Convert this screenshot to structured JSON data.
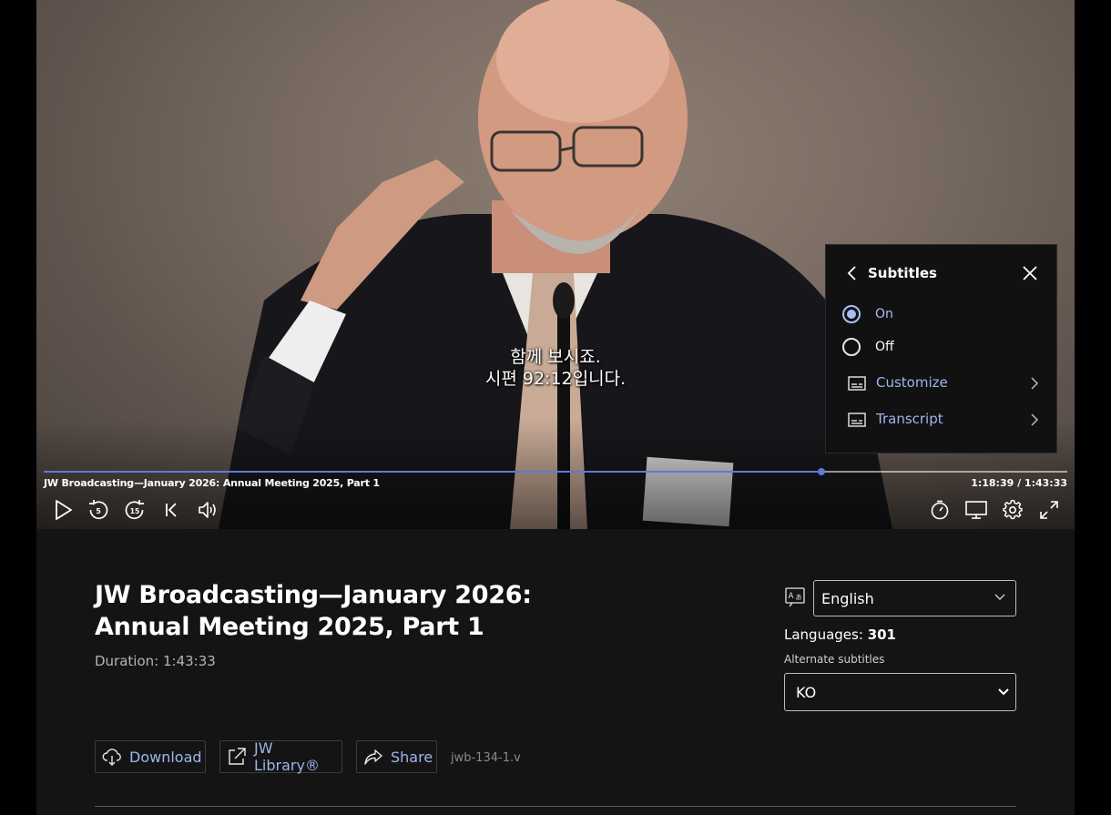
{
  "video": {
    "caption_lines": [
      "함께 보시죠.",
      "시편 92:12입니다."
    ],
    "title": "JW Broadcasting—January 2026: Annual Meeting 2025, Part 1",
    "time": "1:18:39 / 1:43:33",
    "progress": 0.76,
    "controls": [
      "play-icon",
      "rewind-5-icon",
      "forward-15-icon",
      "previous-icon",
      "volume-icon",
      "sleep-timer-icon",
      "cast-icon",
      "settings-icon",
      "fullscreen-icon"
    ]
  },
  "subtitles_menu": {
    "title": "Subtitles",
    "on_label": "On",
    "off_label": "Off",
    "selected": "On",
    "customize_label": "Customize",
    "transcript_label": "Transcript"
  },
  "info": {
    "title_line1": "JW Broadcasting—January 2026:",
    "title_line2": "Annual Meeting 2025, Part 1",
    "duration": "Duration: 1:43:33",
    "language_value": "English",
    "languages_label": "Languages:",
    "languages_count": "301",
    "alternate_subtitles_label": "Alternate subtitles",
    "alternate_subtitles_value": "KO",
    "download_label": "Download",
    "jw_library_label": "JW Library®",
    "share_label": "Share",
    "file_id": "jwb-134-1.v"
  },
  "colors": {
    "accent": "#9fb5ef",
    "progress": "#5b7bd5",
    "background": "#141414"
  }
}
